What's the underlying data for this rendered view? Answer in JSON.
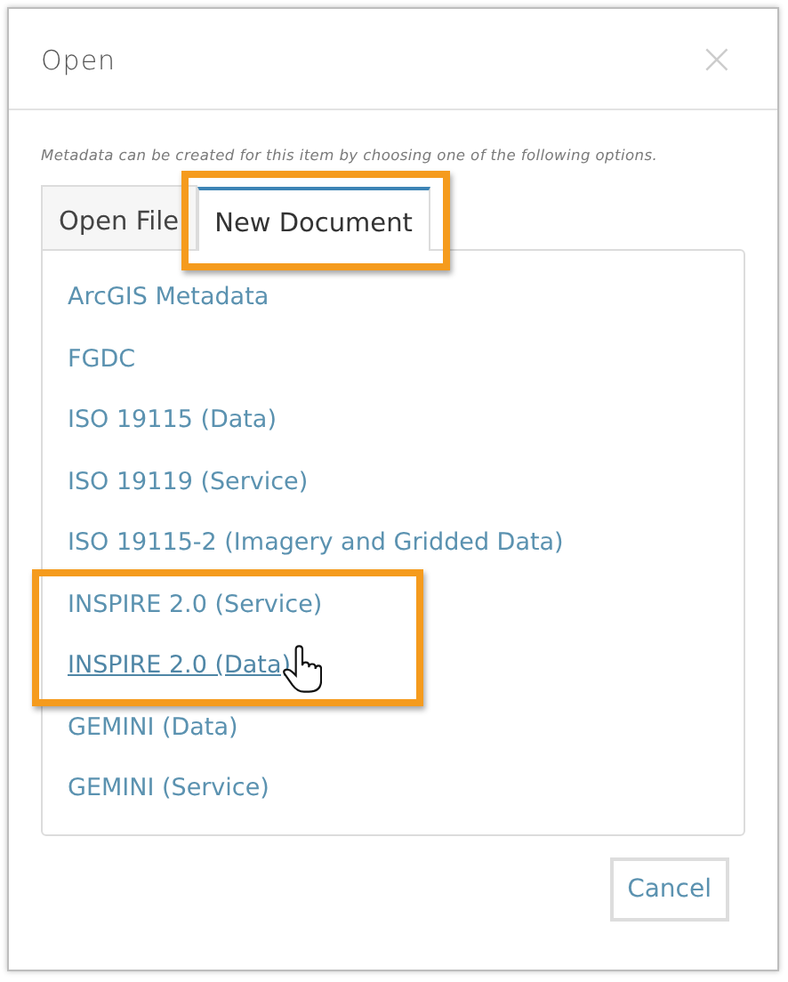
{
  "dialog": {
    "title": "Open",
    "close": "×",
    "description": "Metadata can be created for this item by choosing one of the following options."
  },
  "tabs": [
    {
      "label": "Open File",
      "selected": false,
      "highlighted": false
    },
    {
      "label": "New Document",
      "selected": true,
      "highlighted": true
    }
  ],
  "items": [
    {
      "label": "ArcGIS Metadata",
      "hovered": false,
      "highlighted": false
    },
    {
      "label": "FGDC",
      "hovered": false,
      "highlighted": false
    },
    {
      "label": "ISO 19115 (Data)",
      "hovered": false,
      "highlighted": false
    },
    {
      "label": "ISO 19119 (Service)",
      "hovered": false,
      "highlighted": false
    },
    {
      "label": "ISO 19115-2 (Imagery and Gridded Data)",
      "hovered": false,
      "highlighted": false
    },
    {
      "label": "INSPIRE 2.0 (Service)",
      "hovered": false,
      "highlighted": true
    },
    {
      "label": "INSPIRE 2.0 (Data)",
      "hovered": true,
      "highlighted": true
    },
    {
      "label": "GEMINI (Data)",
      "hovered": false,
      "highlighted": false
    },
    {
      "label": "GEMINI (Service)",
      "hovered": false,
      "highlighted": false
    }
  ],
  "buttons": [
    {
      "label": "Cancel"
    }
  ]
}
